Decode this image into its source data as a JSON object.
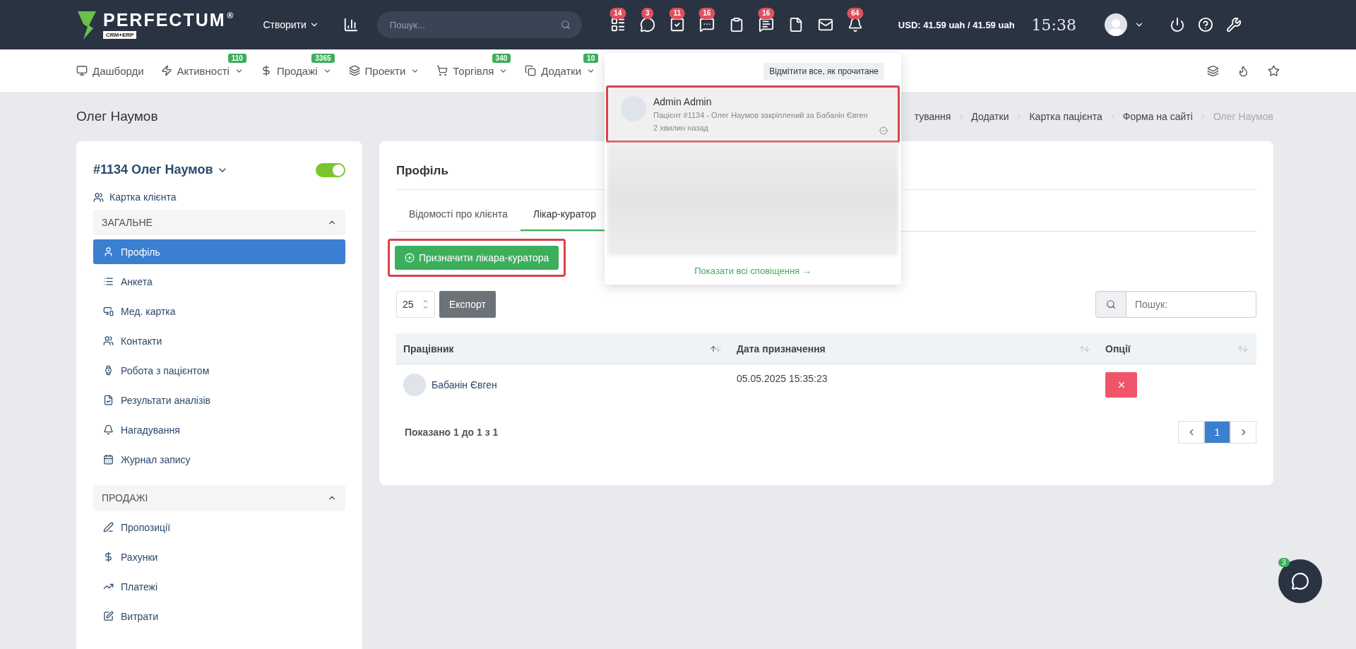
{
  "header": {
    "logo": {
      "name": "PERFECTUM",
      "reg": "®",
      "sub": "CRM+ERP"
    },
    "create_menu": "Створити",
    "search": {
      "placeholder": "Пошук..."
    },
    "icons": [
      {
        "kind": "counter",
        "badge": "14"
      },
      {
        "kind": "counter",
        "badge": "3"
      },
      {
        "kind": "counter",
        "badge": "11"
      },
      {
        "kind": "counter",
        "badge": "16"
      },
      {
        "kind": "plain"
      },
      {
        "kind": "counter",
        "badge": "16"
      },
      {
        "kind": "plain"
      },
      {
        "kind": "plain"
      },
      {
        "kind": "counter",
        "badge": "64"
      }
    ],
    "currency": "USD: 41.59 uah / 41.59 uah",
    "time": "15:38"
  },
  "nav": [
    {
      "label": "Дашборди",
      "dropdown": false
    },
    {
      "label": "Активності",
      "badge": "110",
      "dropdown": true
    },
    {
      "label": "Продажі",
      "badge": "3365",
      "dropdown": true
    },
    {
      "label": "Проекти",
      "dropdown": true
    },
    {
      "label": "Торгівля",
      "badge": "340",
      "dropdown": true
    },
    {
      "label": "Додатки",
      "badge": "10",
      "dropdown": true
    }
  ],
  "page_title": "Олег Наумов",
  "breadcrumb": [
    "тування",
    "Додатки",
    "Картка пацієнта",
    "Форма на сайті",
    "Олег Наумов"
  ],
  "sidebar": {
    "title": "#1134 Олег Наумов",
    "active": true,
    "client_card": "Картка клієнта",
    "sections": [
      {
        "title": "ЗАГАЛЬНЕ",
        "expanded": true,
        "items": [
          {
            "label": "Профіль",
            "selected": true
          },
          {
            "label": "Анкета",
            "selected": false
          },
          {
            "label": "Мед. картка",
            "selected": false
          },
          {
            "label": "Контакти",
            "selected": false
          },
          {
            "label": "Робота з пацієнтом",
            "selected": false
          },
          {
            "label": "Результати аналізів",
            "selected": false
          },
          {
            "label": "Нагадування",
            "selected": false
          },
          {
            "label": "Журнал запису",
            "selected": false
          }
        ]
      },
      {
        "title": "ПРОДАЖІ",
        "expanded": true,
        "items": [
          {
            "label": "Пропозиції",
            "selected": false
          },
          {
            "label": "Рахунки",
            "selected": false
          },
          {
            "label": "Платежі",
            "selected": false
          },
          {
            "label": "Витрати",
            "selected": false
          }
        ]
      }
    ]
  },
  "profile": {
    "title": "Профіль",
    "tabs": [
      {
        "label": "Відомості про клієнта",
        "selected": false
      },
      {
        "label": "Лікар-куратор",
        "selected": true
      }
    ],
    "assign_button": {
      "label": "Призначити лікара-куратора",
      "highlighted": true
    },
    "page_size": "25",
    "export": "Експорт",
    "search": {
      "placeholder": "Пошук:"
    },
    "table": {
      "columns": [
        {
          "label": "Працівник",
          "sorted": true
        },
        {
          "label": "Дата призначення",
          "sorted": false
        },
        {
          "label": "Опції",
          "sorted": false
        }
      ],
      "rows": [
        {
          "employee": "Бабанін Євген",
          "date": "05.05.2025 15:35:23"
        }
      ]
    },
    "summary": "Показано 1 до 1 з 1",
    "pages": [
      {
        "label": "1",
        "selected": true
      }
    ]
  },
  "notifications": {
    "mark_all": "Відмітити все, як прочитане",
    "items": [
      {
        "author": "Admin Admin",
        "text": "Пацієнт #1134 - Олег Наумов закріплений за Бабанін Євген",
        "time": "2 хвилин назад",
        "highlighted": true
      }
    ],
    "show_all": "Показати всі сповіщення →"
  },
  "chat": {
    "badge": "3"
  }
}
